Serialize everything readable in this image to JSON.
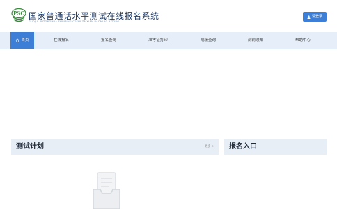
{
  "header": {
    "logo_badge": "PSC",
    "title": "国家普通话水平测试在线报名系统",
    "subtitle": "GUOJIA PUTONGHUA SHUIPING CESHI ZAIXIAN BAOMING XITONG",
    "login_label": "请登录",
    "login_icon": "user-icon"
  },
  "nav": {
    "items": [
      {
        "label": "首页",
        "icon": "home-icon",
        "active": true
      },
      {
        "label": "在线报名"
      },
      {
        "label": "报名查询"
      },
      {
        "label": "准考证打印"
      },
      {
        "label": "成绩查询"
      },
      {
        "label": "测前须知"
      },
      {
        "label": "帮助中心"
      }
    ]
  },
  "sections": {
    "plan": {
      "title": "测试计划",
      "more": "更多 >"
    },
    "entry": {
      "title": "报名入口"
    }
  },
  "colors": {
    "accent": "#3d7fd6",
    "nav_bg": "#e6eff9",
    "section_bg": "#e8eef5",
    "logo_green": "#3a8a3e"
  }
}
